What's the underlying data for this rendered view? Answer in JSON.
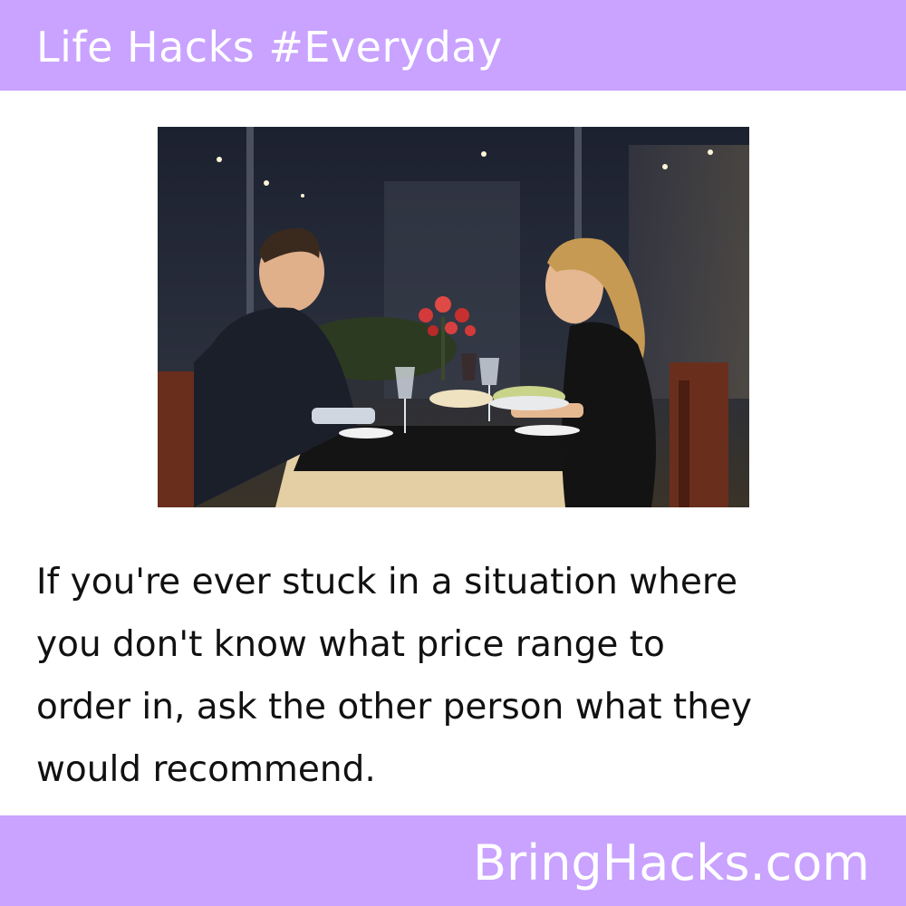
{
  "header": {
    "title": "Life Hacks #Everyday"
  },
  "caption": {
    "text": "If you're ever stuck in a situation where\nyou don't know what price range to\norder in, ask the other person what they\nwould recommend."
  },
  "footer": {
    "brand": "BringHacks.com"
  },
  "colors": {
    "accent_bar": "#c9a3ff",
    "bar_text": "#ffffff",
    "body_text": "#111111",
    "background": "#ffffff"
  }
}
